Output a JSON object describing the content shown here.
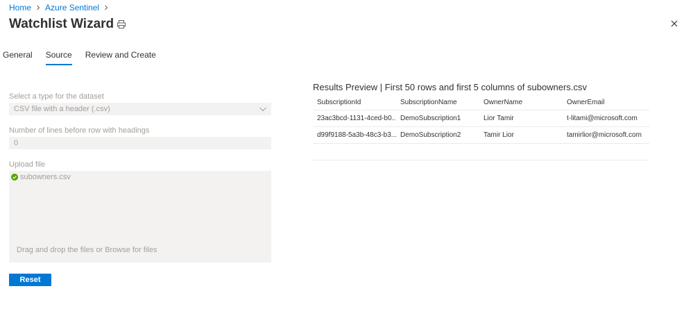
{
  "breadcrumb": {
    "home": "Home",
    "sentinel": "Azure Sentinel"
  },
  "page": {
    "title": "Watchlist Wizard"
  },
  "tabs": [
    "General",
    "Source",
    "Review and Create"
  ],
  "form": {
    "dataset_type_label": "Select a type for the dataset",
    "dataset_type_value": "CSV file with a header (.csv)",
    "lines_label": "Number of lines before row with headings",
    "lines_value": "0",
    "upload_label": "Upload file",
    "file_name": "subowners.csv",
    "drop_text": "Drag and drop the files or Browse for files",
    "reset_label": "Reset"
  },
  "preview": {
    "title": "Results Preview | First 50 rows and first 5 columns of subowners.csv",
    "columns": [
      "SubscriptionId",
      "SubscriptionName",
      "OwnerName",
      "OwnerEmail"
    ],
    "rows": [
      [
        "23ac3bcd-1131-4ced-b0...",
        "DemoSubscription1",
        "Lior Tamir",
        "t-litami@microsoft.com"
      ],
      [
        "d99f9188-5a3b-48c3-b3...",
        "DemoSubscription2",
        "Tamir Lior",
        "tamirlior@microsoft.com"
      ]
    ]
  },
  "colors": {
    "accent": "#0078d4",
    "field_bg": "#f3f2f1",
    "success": "#57a300"
  },
  "icons": [
    "chevron-right-icon",
    "print-icon",
    "close-icon",
    "chevron-down-icon",
    "checkmark-circle-icon"
  ]
}
